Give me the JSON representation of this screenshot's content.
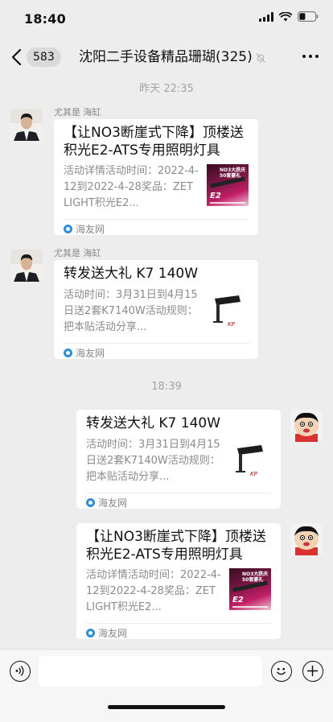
{
  "status_bar": {
    "time": "18:40"
  },
  "nav": {
    "unread_count": "583",
    "title": "沈阳二手设备精品珊瑚(325)"
  },
  "timestamps": {
    "first": "昨天 22:35",
    "second": "18:39"
  },
  "messages": [
    {
      "sender": "尤其是 海缸",
      "title": "【让NO3断崖式下降】顶楼送积光E2-ATS专用照明灯具",
      "desc": "活动详情活动时间：2022-4-12到2022-4-28奖品：ZETLIGHT积光E2...",
      "source": "海友网",
      "thumb_caption": "NO3大跌庆 50套豪礼",
      "thumb_label": "E2"
    },
    {
      "sender": "尤其是 海缸",
      "title": "转发送大礼 K7 140W",
      "desc": "活动时间：3月31日到4月15日送2套K7140W活动规则：把本贴活动分享...",
      "source": "海友网"
    },
    {
      "title": "转发送大礼 K7 140W",
      "desc": "活动时间：3月31日到4月15日送2套K7140W活动规则：把本贴活动分享...",
      "source": "海友网"
    },
    {
      "title": "【让NO3断崖式下降】顶楼送积光E2-ATS专用照明灯具",
      "desc": "活动详情活动时间：2022-4-12到2022-4-28奖品：ZETLIGHT积光E2...",
      "source": "海友网",
      "thumb_caption": "NO3大跌庆 50套豪礼",
      "thumb_label": "E2"
    }
  ],
  "input": {
    "placeholder": ""
  }
}
